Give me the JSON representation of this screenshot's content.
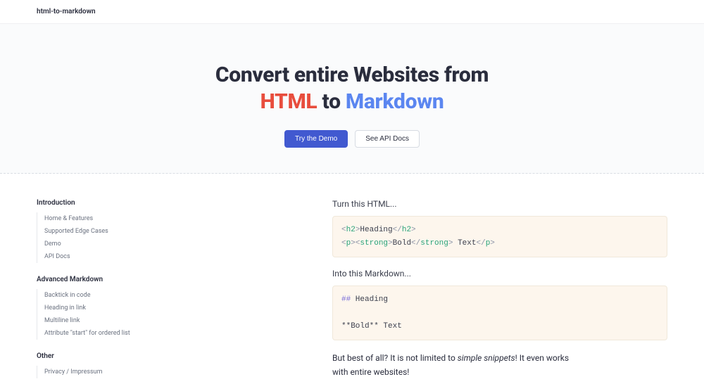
{
  "header": {
    "logo": "html-to-markdown"
  },
  "hero": {
    "line1": "Convert entire Websites from",
    "html_word": "HTML",
    "to_word": " to ",
    "md_word": "Markdown",
    "primary_btn": "Try the Demo",
    "secondary_btn": "See API Docs"
  },
  "sidebar": {
    "groups": [
      {
        "title": "Introduction",
        "items": [
          "Home & Features",
          "Supported Edge Cases",
          "Demo",
          "API Docs"
        ]
      },
      {
        "title": "Advanced Markdown",
        "items": [
          "Backtick in code",
          "Heading in link",
          "Multiline link",
          "Attribute \"start\" for ordered list"
        ]
      },
      {
        "title": "Other",
        "items": [
          "Privacy / Impressum"
        ]
      }
    ]
  },
  "main": {
    "turn_label": "Turn this HTML...",
    "html_code": {
      "h2_open": "h2",
      "h2_text": "Heading",
      "h2_close": "h2",
      "p_open": "p",
      "strong_open": "strong",
      "bold_text": "Bold",
      "strong_close": "strong",
      "tail_text": " Text",
      "p_close": "p"
    },
    "into_label": "Into this Markdown...",
    "md_code": {
      "hash": "##",
      "heading": " Heading",
      "bold": "**Bold**",
      "text": " Text"
    },
    "para_prefix": "But best of all? It is not limited to ",
    "para_em": "simple snippets",
    "para_suffix": "! It even works",
    "para_line2": "with entire websites!"
  }
}
